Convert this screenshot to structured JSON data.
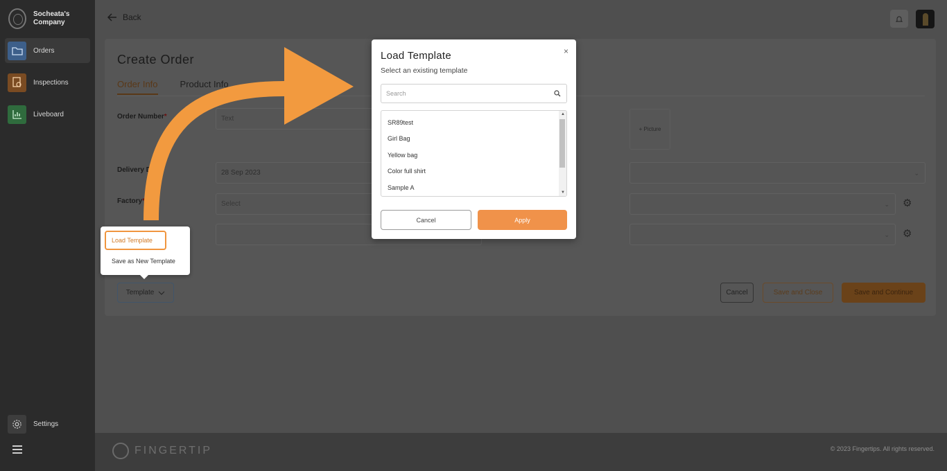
{
  "app": {
    "company": "Socheata's Company"
  },
  "sidebar": {
    "items": [
      {
        "label": "Orders",
        "icon": "folder-icon",
        "color": "#3d5f8a"
      },
      {
        "label": "Inspections",
        "icon": "inspection-icon",
        "color": "#7a4b22"
      },
      {
        "label": "Liveboard",
        "icon": "chart-icon",
        "color": "#2f6b3d"
      }
    ],
    "settings_label": "Settings"
  },
  "topbar": {
    "back_label": "Back"
  },
  "page": {
    "title": "Create Order",
    "tabs": [
      "Order Info",
      "Product Info"
    ],
    "fields": {
      "order_number_label": "Order Number",
      "order_number_placeholder": "Text",
      "delivery_date_label": "Delivery Da",
      "delivery_date_value": "28 Sep 2023",
      "factory_label": "Factory",
      "factory_placeholder": "Select",
      "picture_label": "+ Picture"
    },
    "buttons": {
      "template": "Template",
      "cancel": "Cancel",
      "save_close": "Save and Close",
      "save_continue": "Save and Continue"
    }
  },
  "popover": {
    "load_template": "Load Template",
    "save_new_template": "Save as New Template"
  },
  "modal": {
    "title": "Load Template",
    "subtitle": "Select an existing template",
    "close": "×",
    "search_placeholder": "Search",
    "templates": [
      "SR89test",
      "Girl Bag",
      "Yellow bag",
      "Color full shirt",
      "Sample A"
    ],
    "cancel": "Cancel",
    "apply": "Apply"
  },
  "footer": {
    "logo_text": "FINGERTIP",
    "copyright": "© 2023 Fingertips. All rights reserved."
  },
  "colors": {
    "accent": "#f0924a",
    "sidebar": "#2b2b2b"
  }
}
